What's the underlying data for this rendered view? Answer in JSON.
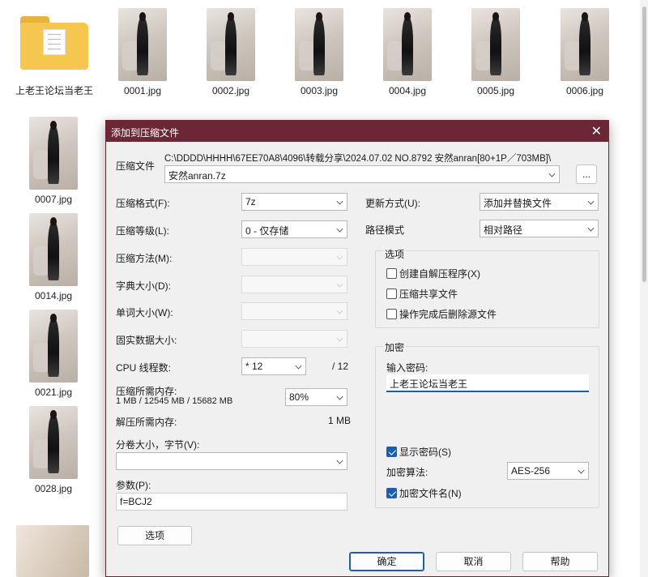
{
  "explorer": {
    "folder_name": "上老王论坛当老王",
    "files": [
      "0001.jpg",
      "0002.jpg",
      "0003.jpg",
      "0004.jpg",
      "0005.jpg",
      "0006.jpg",
      "0007.jpg",
      "0014.jpg",
      "0021.jpg",
      "0028.jpg"
    ]
  },
  "dialog": {
    "title": "添加到压缩文件",
    "close_icon": "close-icon",
    "archive": {
      "label": "压缩文件",
      "path": "C:\\DDDD\\HHHH\\67EE70A8\\4096\\转载分享\\2024.07.02 NO.8792 安然anran[80+1P／703MB]\\",
      "name": "安然anran.7z",
      "browse_label": "..."
    },
    "left": {
      "format_label": "压缩格式(F):",
      "format_value": "7z",
      "level_label": "压缩等级(L):",
      "level_value": "0 - 仅存储",
      "method_label": "压缩方法(M):",
      "dict_label": "字典大小(D):",
      "word_label": "单词大小(W):",
      "solid_label": "固实数据大小:",
      "threads_label": "CPU 线程数:",
      "threads_value": "* 12",
      "threads_total": "/ 12",
      "mem_label": "压缩所需内存:",
      "mem_detail": "1 MB / 12545 MB / 15682 MB",
      "mem_percent": "80%",
      "decomp_label": "解压所需内存:",
      "decomp_value": "1 MB",
      "volume_label": "分卷大小，字节(V):",
      "volume_value": "",
      "params_label": "参数(P):",
      "params_value": "f=BCJ2",
      "options_button": "选项"
    },
    "right": {
      "update_label": "更新方式(U):",
      "update_value": "添加并替换文件",
      "pathmode_label": "路径模式",
      "pathmode_value": "相对路径",
      "options_group": "选项",
      "opt_sfx": "创建自解压程序(X)",
      "opt_shared": "压缩共享文件",
      "opt_delete": "操作完成后删除源文件",
      "encrypt_group": "加密",
      "password_label": "输入密码:",
      "password_value": "上老王论坛当老王",
      "show_password": "显示密码(S)",
      "algo_label": "加密算法:",
      "algo_value": "AES-256",
      "encrypt_names": "加密文件名(N)"
    },
    "buttons": {
      "ok": "确定",
      "cancel": "取消",
      "help": "帮助"
    }
  },
  "colors": {
    "titlebar": "#6b2834",
    "accent": "#1a5fb4"
  }
}
